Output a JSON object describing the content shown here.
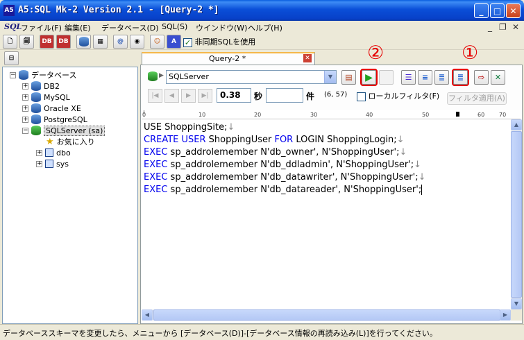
{
  "window": {
    "icon_text": "A5",
    "title": "A5:SQL Mk-2 Version 2.1 - [Query-2 *]",
    "controls": {
      "minimize": "_",
      "maximize": "□",
      "close": "✕"
    }
  },
  "menubar": {
    "sql_label": "SQL",
    "items": [
      "ファイル(F)",
      "編集(E)",
      "データベース(D)",
      "SQL(S)",
      "ウインドウ(W)",
      "ヘルプ(H)"
    ],
    "mdi_controls": {
      "minimize": "_",
      "restore": "❐",
      "close": "✕"
    }
  },
  "toolbar": {
    "buttons": [
      "new-document",
      "open-document",
      "db-connect",
      "db-disconnect",
      "database",
      "qr-table",
      "at-sign",
      "search-db",
      "person",
      "a5-logo"
    ],
    "async_sql_checked": true,
    "async_sql_label": "非同期SQLを使用"
  },
  "tree": {
    "root_label": "データベース",
    "root_expander": "−",
    "items": [
      {
        "label": "DB2",
        "expander": "+",
        "color": "blue"
      },
      {
        "label": "MySQL",
        "expander": "+",
        "color": "blue"
      },
      {
        "label": "Oracle XE",
        "expander": "+",
        "color": "blue"
      },
      {
        "label": "PostgreSQL",
        "expander": "+",
        "color": "blue"
      },
      {
        "label": "SQLServer (sa)",
        "expander": "−",
        "color": "green",
        "selected": true
      }
    ],
    "children": [
      {
        "label": "お気に入り",
        "icon": "star-icon"
      },
      {
        "label": "dbo",
        "expander": "+",
        "icon": "schema-icon"
      },
      {
        "label": "sys",
        "expander": "+",
        "icon": "schema-icon"
      }
    ]
  },
  "query_tab": {
    "label": "Query-2 *",
    "close": "✕"
  },
  "connection": {
    "selected": "SQLServer"
  },
  "annotations": {
    "one": "①",
    "two": "②"
  },
  "nav": {
    "seconds_value": "0.38",
    "seconds_label": "秒",
    "count_value": "",
    "count_label": "件",
    "cursor_pos": "(6, 57)",
    "local_filter_label": "ローカルフィルタ(F)",
    "local_filter_checked": false,
    "filter_apply_label": "フィルタ適用(A)"
  },
  "ruler": {
    "labels": [
      "10",
      "20",
      "30",
      "40",
      "50",
      "60",
      "70"
    ]
  },
  "editor": {
    "lines": [
      {
        "parts": [
          [
            "USE ShoppingSite;",
            "t"
          ],
          [
            "↓",
            "nl"
          ]
        ]
      },
      {
        "parts": [
          [
            "CREATE USER",
            "kw"
          ],
          [
            " ShoppingUser ",
            "t"
          ],
          [
            "FOR",
            "kw"
          ],
          [
            " LOGIN ShoppingLogin;",
            "t"
          ],
          [
            "↓",
            "nl"
          ]
        ]
      },
      {
        "parts": [
          [
            "EXEC",
            "kw"
          ],
          [
            " sp_addrolemember N'db_owner', N'ShoppingUser';",
            "t"
          ],
          [
            "↓",
            "nl"
          ]
        ]
      },
      {
        "parts": [
          [
            "EXEC",
            "kw"
          ],
          [
            " sp_addrolemember N'db_ddladmin', N'ShoppingUser';",
            "t"
          ],
          [
            "↓",
            "nl"
          ]
        ]
      },
      {
        "parts": [
          [
            "EXEC",
            "kw"
          ],
          [
            " sp_addrolemember N'db_datawriter', N'ShoppingUser';",
            "t"
          ],
          [
            "↓",
            "nl"
          ]
        ]
      },
      {
        "parts": [
          [
            "EXEC",
            "kw"
          ],
          [
            " sp_addrolemember N'db_datareader', N'ShoppingUser';",
            "t"
          ]
        ]
      }
    ]
  },
  "statusbar": {
    "message": "データベーススキーマを変更したら、メニューから [データベース(D)]-[データベース情報の再読み込み(L)]を行ってください。"
  }
}
